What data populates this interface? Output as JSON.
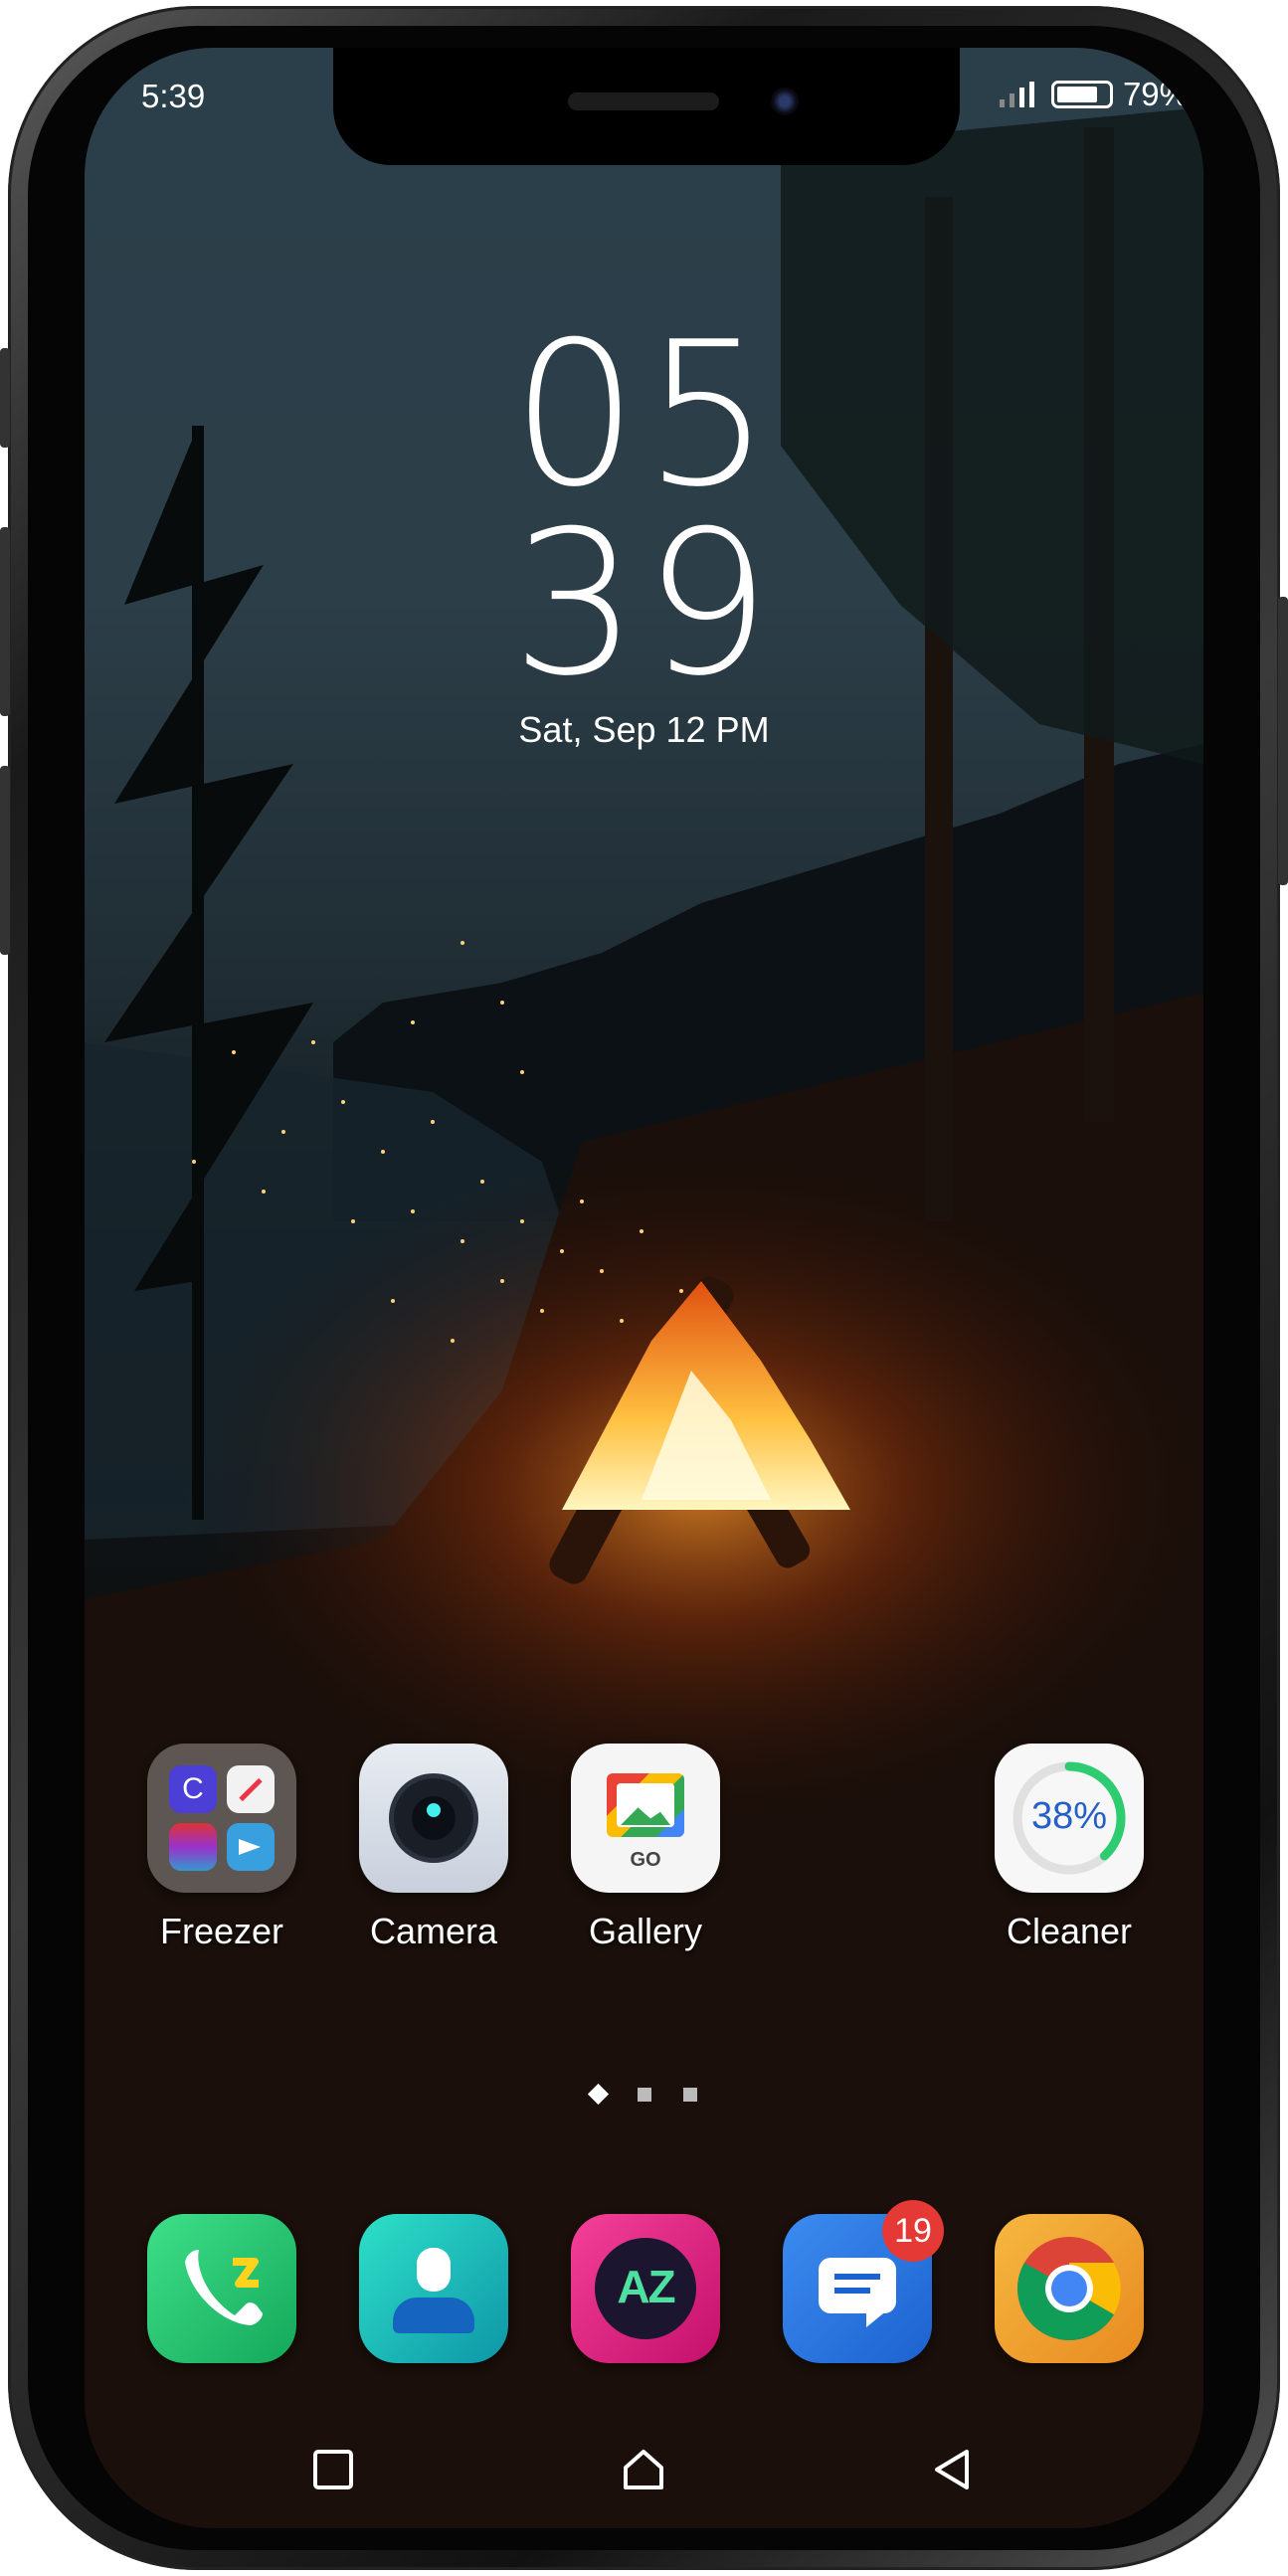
{
  "status_bar": {
    "time": "5:39",
    "battery_percent": "79%",
    "battery_level": 0.79
  },
  "clock": {
    "hours": "05",
    "minutes": "39",
    "date": "Sat, Sep 12 PM"
  },
  "apps": [
    {
      "label": "Freezer",
      "icon": "folder-icon"
    },
    {
      "label": "Camera",
      "icon": "camera-icon"
    },
    {
      "label": "Gallery",
      "icon": "gallery-icon",
      "sub_label": "GO"
    },
    {
      "label": "Cleaner",
      "icon": "cleaner-icon",
      "value": "38%",
      "level": 0.38
    }
  ],
  "page_indicator": {
    "pages": 3,
    "active": 0
  },
  "dock": [
    {
      "icon": "phone-icon"
    },
    {
      "icon": "contacts-icon"
    },
    {
      "icon": "az-icon",
      "text": "AZ"
    },
    {
      "icon": "messages-icon",
      "badge": "19"
    },
    {
      "icon": "chrome-icon"
    }
  ],
  "colors": {
    "badge": "#e53935",
    "phone": "#22c36a",
    "contacts": "#18b6a8",
    "az": "#e6287a",
    "messages": "#2a7be6",
    "chrome": "#f0a030",
    "cleaner_ring": "#2ecc71"
  }
}
